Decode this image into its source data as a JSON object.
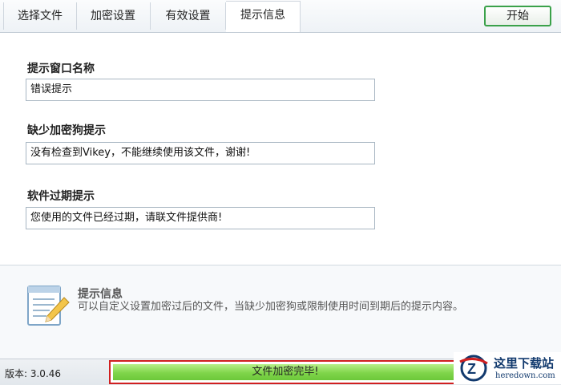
{
  "tabs": [
    {
      "label": "选择文件"
    },
    {
      "label": "加密设置"
    },
    {
      "label": "有效设置"
    },
    {
      "label": "提示信息",
      "active": true
    }
  ],
  "toolbar": {
    "start_label": "开始"
  },
  "form": {
    "window_name": {
      "label": "提示窗口名称",
      "value": "错误提示"
    },
    "missing_dongle": {
      "label": "缺少加密狗提示",
      "value": "没有检查到Vikey，不能继续使用该文件，谢谢!"
    },
    "expired": {
      "label": "软件过期提示",
      "value": "您使用的文件已经过期，请联文件提供商!"
    }
  },
  "info": {
    "icon": "notepad-pencil-icon",
    "title": "提示信息",
    "description": "可以自定义设置加密过后的文件，当缺少加密狗或限制使用时间到期后的提示内容。"
  },
  "status": {
    "version": "版本: 3.0.46",
    "progress_label": "文件加密完毕!",
    "progress_fraction": 1.0
  },
  "watermark": {
    "text_cn": "这里下载站",
    "text_url": "heredown.com"
  },
  "colors": {
    "progress_green": "#7fd54a",
    "highlight_red": "#d02020",
    "start_border": "#3aa14a"
  }
}
